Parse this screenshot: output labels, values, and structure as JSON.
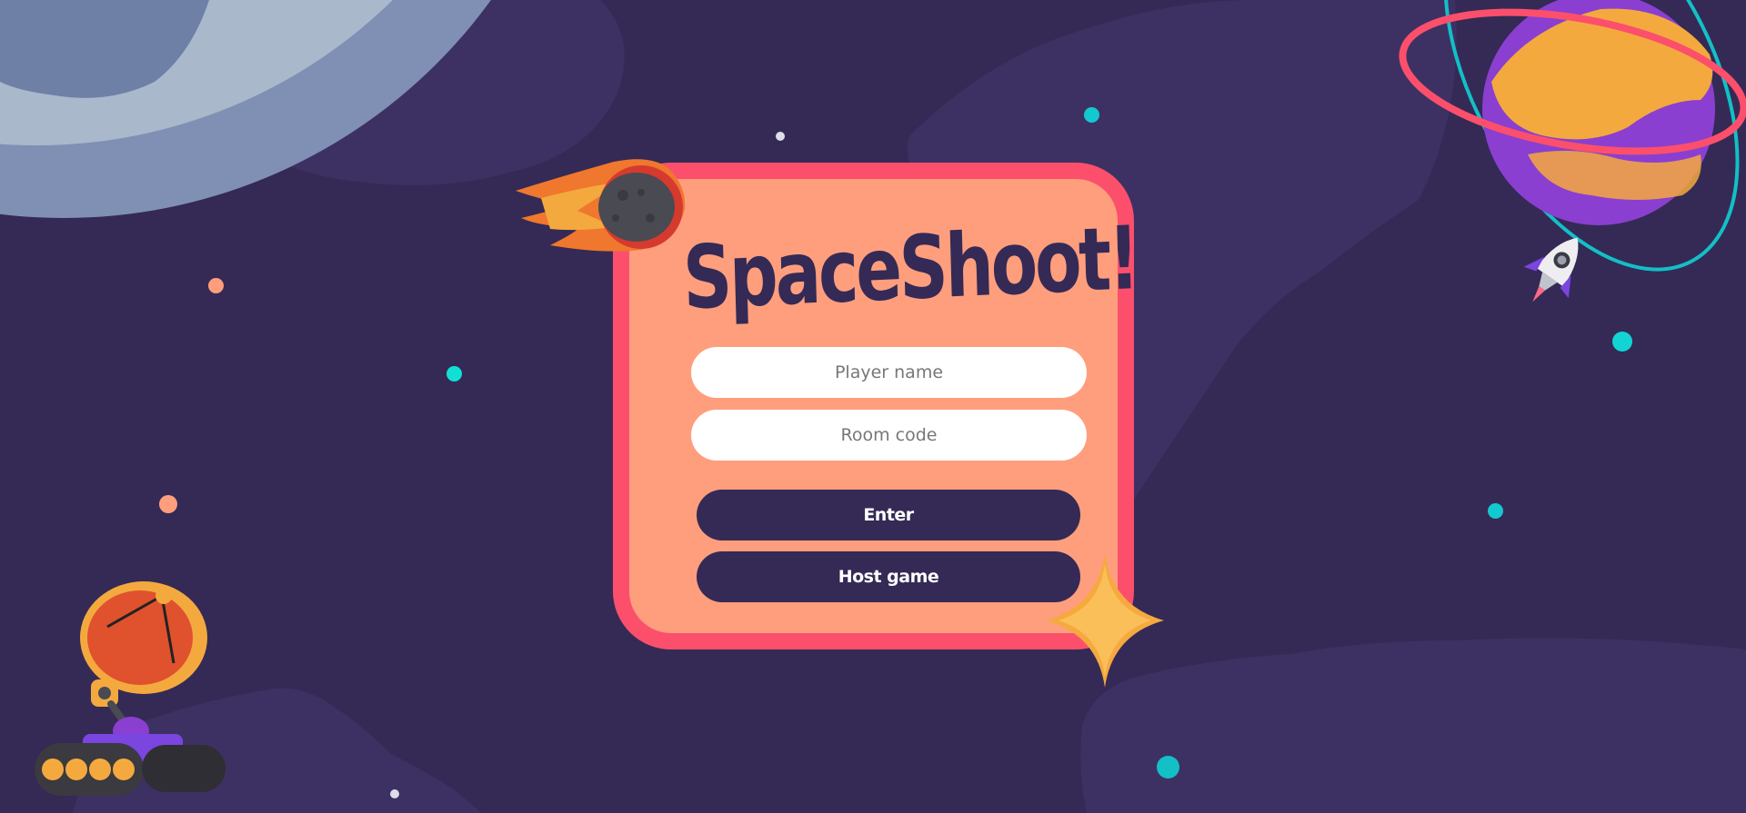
{
  "app": {
    "title": "SpaceShoot!"
  },
  "form": {
    "player_name_placeholder": "Player name",
    "player_name_value": "",
    "room_code_placeholder": "Room code",
    "room_code_value": ""
  },
  "buttons": {
    "enter_label": "Enter",
    "host_label": "Host game"
  },
  "icons": {
    "moon": "moon-icon",
    "comet": "comet-icon",
    "planet": "ringed-planet-icon",
    "rocket": "rocket-icon",
    "star": "star-icon",
    "rover": "satellite-rover-icon"
  },
  "colors": {
    "background": "#342a55",
    "card_fill": "#ff9e7d",
    "card_border": "#fc4f6c",
    "button": "#342a55",
    "accent_cyan": "#00d4d4"
  }
}
